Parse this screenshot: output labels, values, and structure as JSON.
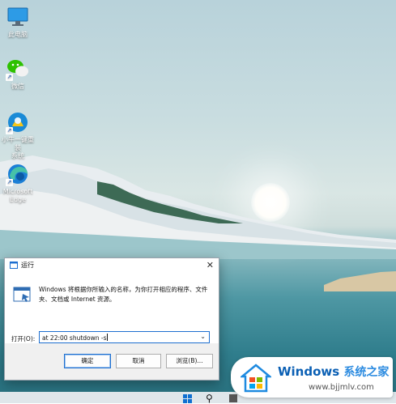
{
  "desktop_icons": [
    {
      "label": "此电脑",
      "icon": "computer-icon"
    },
    {
      "label": "微信",
      "icon": "wechat-icon"
    },
    {
      "label": "小牛一键重装\n系统",
      "icon": "installer-icon"
    },
    {
      "label": "Microsoft\nEdge",
      "icon": "edge-icon"
    }
  ],
  "run_dialog": {
    "title": "运行",
    "description": "Windows 将根据你所输入的名称，为你打开相应的程序、文件夹、文档或 Internet 资源。",
    "open_label": "打开(O):",
    "command_value": "at 22:00 shutdown -s",
    "ok_label": "确定",
    "cancel_label": "取消",
    "browse_label": "浏览(B)..."
  },
  "watermark": {
    "brand": "Windows",
    "brand_cn": "系统之家",
    "url": "www.bjjmlv.com"
  },
  "colors": {
    "accent": "#1e6fd0",
    "watermark_blue": "#0a5fb4"
  }
}
